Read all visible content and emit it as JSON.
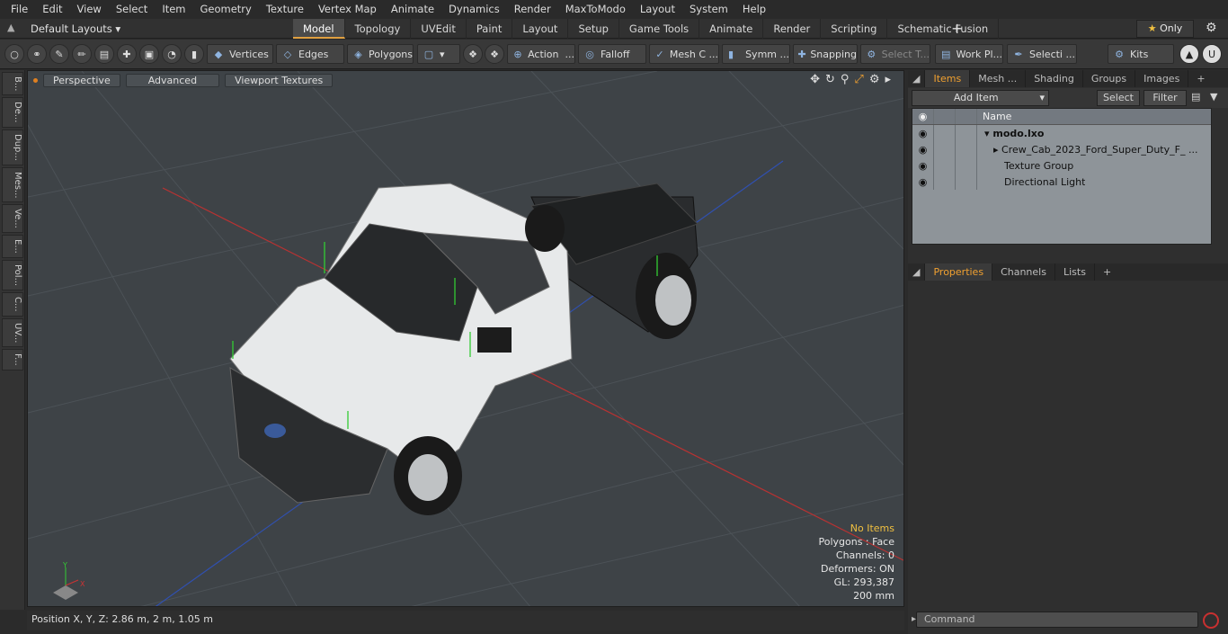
{
  "menu": [
    "File",
    "Edit",
    "View",
    "Select",
    "Item",
    "Geometry",
    "Texture",
    "Vertex Map",
    "Animate",
    "Dynamics",
    "Render",
    "MaxToModo",
    "Layout",
    "System",
    "Help"
  ],
  "layoutbar": {
    "default_layouts": "Default Layouts",
    "tabs": [
      "Model",
      "Topology",
      "UVEdit",
      "Paint",
      "Layout",
      "Setup",
      "Game Tools",
      "Animate",
      "Render",
      "Scripting",
      "Schematic Fusion"
    ],
    "active_tab": "Model",
    "only_label": "Only"
  },
  "toolbar": {
    "vertices": "Vertices",
    "edges": "Edges",
    "polygons": "Polygons",
    "action": "Action",
    "falloff": "Falloff",
    "mesh": "Mesh C ...",
    "symm": "Symm ...",
    "snapping": "Snapping",
    "select_t": "Select T...",
    "work_pl": "Work Pl...",
    "selecti": "Selecti ...",
    "kits": "Kits"
  },
  "left_tabs": [
    "B...",
    "De...",
    "Dup...",
    "Mes...",
    "Ve...",
    "E...",
    "Pol...",
    "C...",
    "UV...",
    "F..."
  ],
  "viewport": {
    "perspective": "Perspective",
    "advanced": "Advanced",
    "viewport_textures": "Viewport Textures",
    "info": {
      "no_items": "No Items",
      "polygons": "Polygons : Face",
      "channels": "Channels: 0",
      "deformers": "Deformers: ON",
      "gl": "GL: 293,387",
      "scale": "200 mm"
    }
  },
  "status": {
    "position_label": "Position X, Y, Z:",
    "position_value": "2.86 m, 2 m, 1.05 m"
  },
  "items_panel": {
    "tabs": [
      "Items",
      "Mesh ...",
      "Shading",
      "Groups",
      "Images"
    ],
    "add_item": "Add Item",
    "select": "Select",
    "filter": "Filter",
    "name_header": "Name",
    "rows": [
      {
        "name": "modo.lxo",
        "bold": true
      },
      {
        "name": "Crew_Cab_2023_Ford_Super_Duty_F_ ..."
      },
      {
        "name": "Texture Group"
      },
      {
        "name": "Directional Light"
      }
    ]
  },
  "props_panel": {
    "tabs": [
      "Properties",
      "Channels",
      "Lists"
    ]
  },
  "command": {
    "placeholder": "Command"
  },
  "colors": {
    "accent": "#f0a030",
    "viewport_bg": "#3e4347",
    "panel_bg": "#2f2f2f"
  }
}
